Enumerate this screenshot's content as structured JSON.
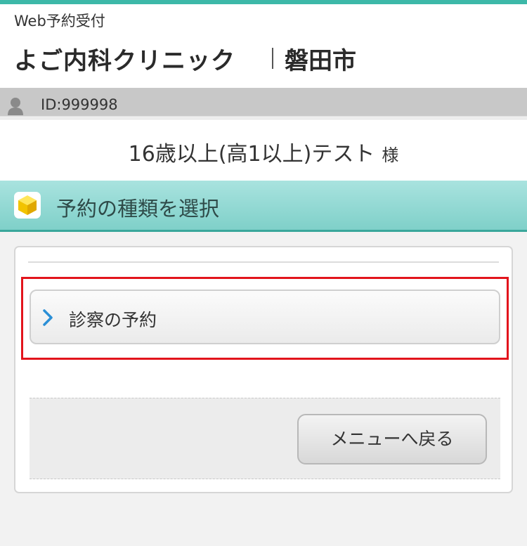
{
  "header": {
    "app_label": "Web予約受付",
    "clinic_name": "よご内科クリニック",
    "clinic_city": "磐田市"
  },
  "user": {
    "id_text": "ID:999998",
    "patient_name": "16歳以上(高1以上)テスト",
    "honorific": "様"
  },
  "section": {
    "title": "予約の種類を選択",
    "icon": "cube-icon"
  },
  "options": [
    {
      "label": "診察の予約",
      "icon": "chevron-right-icon",
      "highlighted": true
    }
  ],
  "footer": {
    "back_label": "メニューへ戻る"
  },
  "colors": {
    "accent": "#3db8a8",
    "section_bar": "#7fd0c9",
    "highlight_border": "#e2141c",
    "chevron": "#2b8fd6"
  }
}
